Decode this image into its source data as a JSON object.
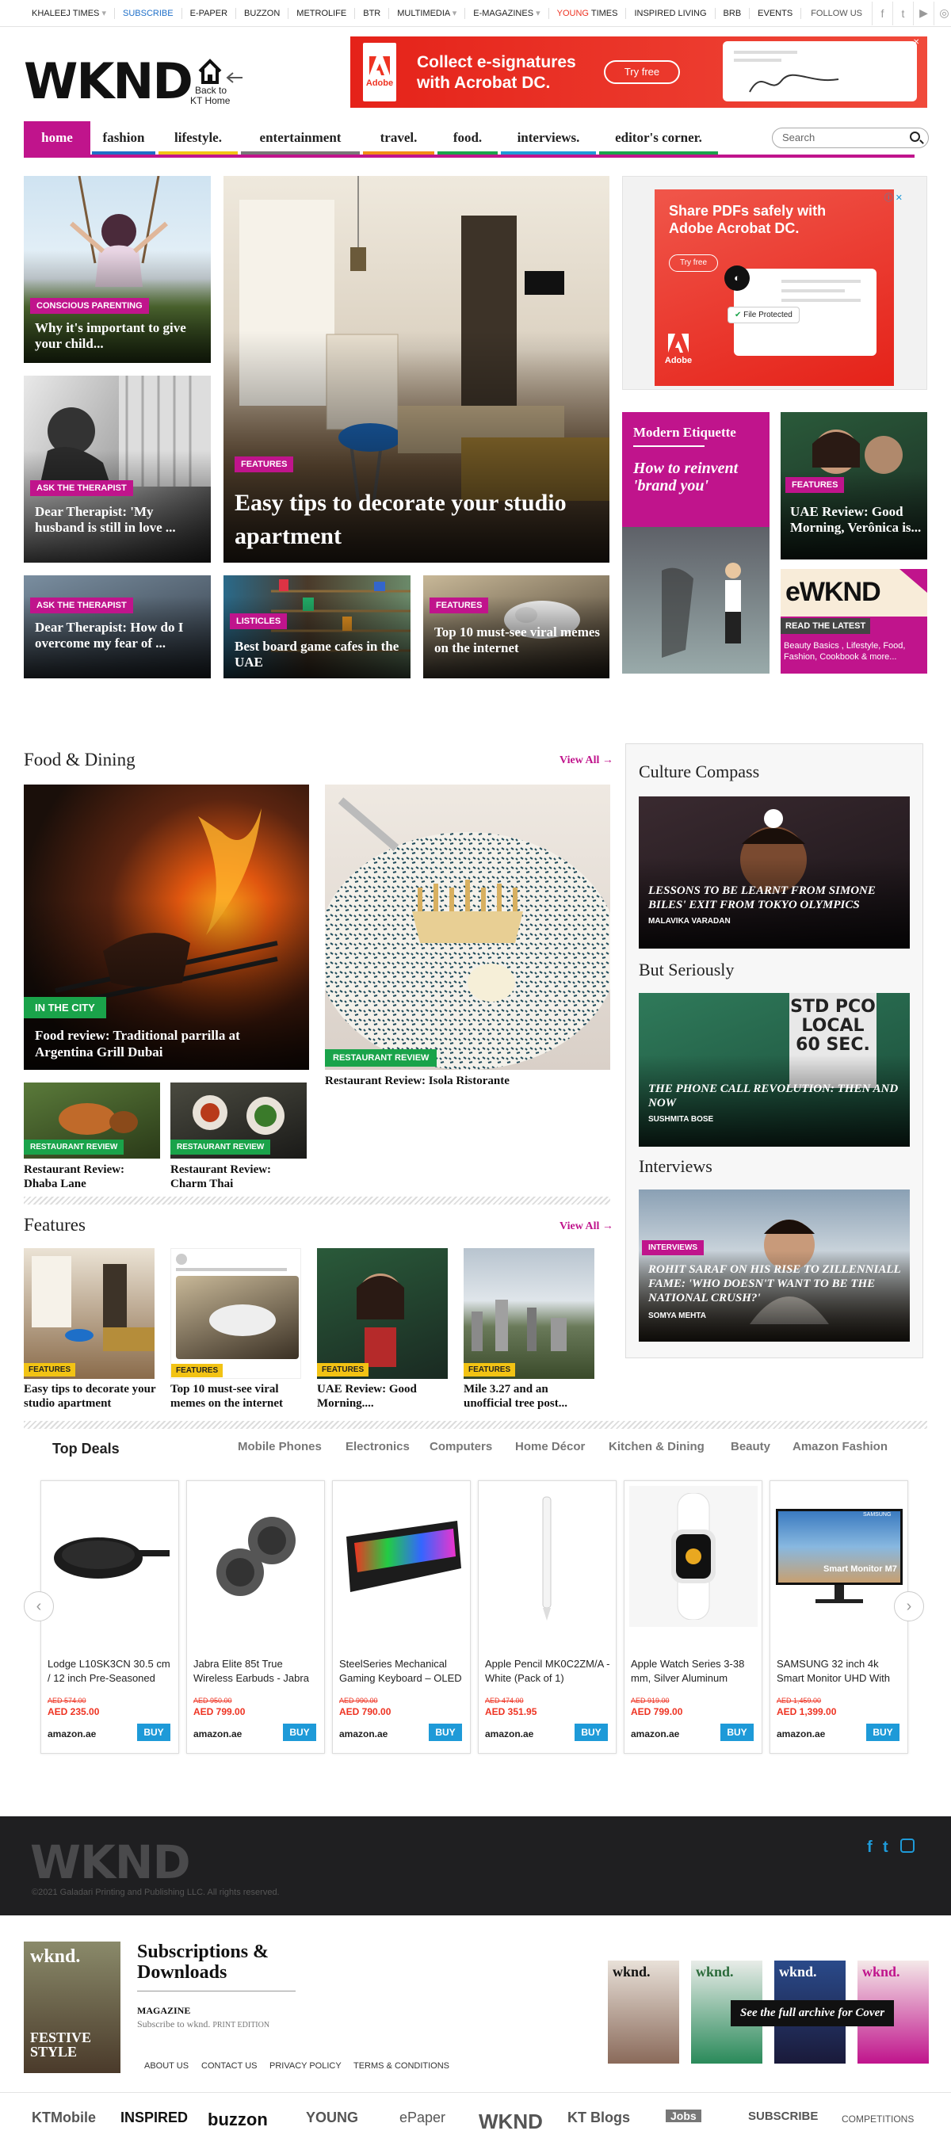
{
  "topbar": {
    "items": [
      "KHALEEJ TIMES",
      "SUBSCRIBE",
      "E-PAPER",
      "BUZZON",
      "METROLIFE",
      "BTR",
      "MULTIMEDIA",
      "E-MAGAZINES",
      "YOUNG",
      "TIMES",
      "INSPIRED LIVING",
      "BRB",
      "EVENTS"
    ],
    "follow": "FOLLOW US"
  },
  "brand": {
    "logo": "WKND",
    "back1": "Back to",
    "back2": "KT Home"
  },
  "ad_top": {
    "line1": "Collect e-signatures",
    "line2": "with Acrobat DC.",
    "btn": "Try free",
    "brand": "Adobe"
  },
  "nav": {
    "items": [
      "home",
      "fashion",
      "lifestyle.",
      "entertainment",
      "travel.",
      "food.",
      "interviews.",
      "editor's corner."
    ],
    "search_placeholder": "Search"
  },
  "hero": {
    "left1": {
      "tag": "CONSCIOUS PARENTING",
      "title": "Why it's important to give your child..."
    },
    "left2": {
      "tag": "ASK THE THERAPIST",
      "title": "Dear Therapist: 'My husband is still in love ..."
    },
    "main": {
      "tag": "FEATURES",
      "title": "Easy tips to decorate your studio apartment"
    },
    "row1": {
      "tag": "ASK THE THERAPIST",
      "title": "Dear Therapist: How do I overcome my fear of ..."
    },
    "row2": {
      "tag": "LISTICLES",
      "title": "Best board game cafes in the UAE"
    },
    "row3": {
      "tag": "FEATURES",
      "title": "Top 10 must-see viral memes on the internet"
    }
  },
  "ad_side": {
    "line1": "Share PDFs safely with",
    "line2": "Adobe Acrobat DC.",
    "btn": "Try free",
    "badge": "File Protected",
    "brand": "Adobe"
  },
  "etiquette": {
    "head": "Modern Etiquette",
    "title": "How to reinvent 'brand you'"
  },
  "uae": {
    "tag": "FEATURES",
    "title": "UAE Review: Good Morning, Verônica is..."
  },
  "ewknd": {
    "logo": "eWKND",
    "read": "READ THE LATEST",
    "sub": "Beauty Basics , Lifestyle, Food, Fashion, Cookbook & more..."
  },
  "food": {
    "head": "Food & Dining",
    "viewall": "View All →",
    "big1": {
      "tag": "IN THE CITY",
      "title": "Food review: Traditional parrilla at Argentina Grill Dubai"
    },
    "big2": {
      "tag": "RESTAURANT REVIEW",
      "title": "Restaurant Review: Isola Ristorante"
    },
    "s1": {
      "tag": "RESTAURANT REVIEW",
      "title": "Restaurant Review: Dhaba Lane"
    },
    "s2": {
      "tag": "RESTAURANT REVIEW",
      "title": "Restaurant Review: Charm Thai"
    }
  },
  "features": {
    "head": "Features",
    "viewall": "View All →",
    "items": [
      {
        "tag": "FEATURES",
        "title": "Easy tips to decorate your studio apartment"
      },
      {
        "tag": "FEATURES",
        "title": "Top 10 must-see viral memes on the internet"
      },
      {
        "tag": "FEATURES",
        "title": "UAE Review: Good Morning...."
      },
      {
        "tag": "FEATURES",
        "title": "Mile 3.27 and an unofficial tree post..."
      }
    ]
  },
  "culture": {
    "head1": "Culture Compass",
    "c1": "LESSONS TO BE LEARNT FROM SIMONE BILES' EXIT FROM TOKYO OLYMPICS",
    "a1": "MALAVIKA VARADAN",
    "head2": "But Seriously",
    "c2": "THE PHONE CALL REVOLUTION: THEN AND NOW",
    "a2": "SUSHMITA BOSE",
    "sign": "STD PCO LOCAL 60 SEC.",
    "head3": "Interviews",
    "tag3": "INTERVIEWS",
    "c3": "ROHIT SARAF ON HIS RISE TO ZILLENNIALL FAME: 'WHO DOESN'T WANT TO BE THE NATIONAL CRUSH?'",
    "a3": "SOMYA MEHTA"
  },
  "deals": {
    "head": "Top Deals",
    "tabs": [
      "Mobile Phones",
      "Electronics",
      "Computers",
      "Home Décor",
      "Kitchen & Dining",
      "Beauty",
      "Amazon Fashion"
    ],
    "items": [
      {
        "name": "Lodge L10SK3CN 30.5 cm / 12 inch Pre-Seasoned",
        "old": "AED 574.00",
        "price": "AED 235.00"
      },
      {
        "name": "Jabra Elite 85t True Wireless Earbuds - Jabra",
        "old": "AED 950.00",
        "price": "AED 799.00"
      },
      {
        "name": "SteelSeries Mechanical Gaming Keyboard – OLED",
        "old": "AED 990.00",
        "price": "AED 790.00"
      },
      {
        "name": "Apple Pencil MK0C2ZM/A - White (Pack of 1)",
        "old": "AED 474.00",
        "price": "AED 351.95"
      },
      {
        "name": "Apple Watch Series 3-38 mm, Silver Aluminum",
        "old": "AED 919.00",
        "price": "AED 799.00"
      },
      {
        "name": "SAMSUNG 32 inch 4k Smart Monitor UHD With",
        "old": "AED 1,459.00",
        "price": "AED 1,399.00"
      }
    ],
    "amz": "amazon.ae",
    "buy": "BUY",
    "monitor": "Smart Monitor M7",
    "samsung": "SAMSUNG"
  },
  "footer": {
    "logo": "WKND",
    "copy": "©2021 Galadari Printing and Publishing LLC. All rights reserved."
  },
  "subs": {
    "head1": "Subscriptions &",
    "head2": "Downloads",
    "mag": "MAGAZINE",
    "line": "Subscribe to wknd.",
    "print": "PRINT EDITION",
    "archive": "See the full archive for Cover",
    "cover": "wknd.",
    "festive": "FESTIVE STYLE",
    "links": [
      "ABOUT US",
      "CONTACT US",
      "PRIVACY POLICY",
      "TERMS & CONDITIONS"
    ]
  },
  "brands": [
    "KTMobile",
    "INSPIRED",
    "buzzon",
    "YOUNG",
    "ePaper",
    "WKND",
    "KT Blogs",
    "Jobs",
    "SUBSCRIBE",
    "COMPETITIONS"
  ],
  "colors": {
    "accent": "#c0148c",
    "green": "#1aa34a",
    "yellow": "#f2c314"
  }
}
